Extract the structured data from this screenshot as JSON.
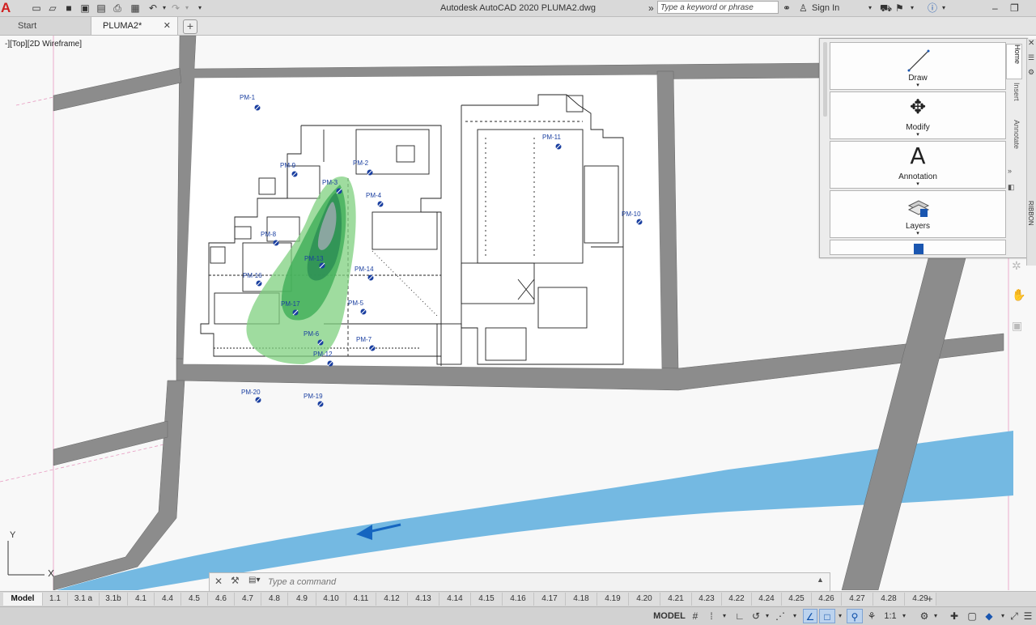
{
  "app": {
    "logo": "A",
    "title": "Autodesk AutoCAD 2020    PLUMA2.dwg",
    "search_placeholder": "Type a keyword or phrase",
    "sign_in": "Sign In"
  },
  "file_tabs": [
    {
      "label": "Start"
    },
    {
      "label": "PLUMA2*"
    }
  ],
  "viewport": {
    "label": "-][Top][2D Wireframe]",
    "axis_y": "Y",
    "axis_x": "X"
  },
  "monitoring_points": [
    "PM-1",
    "PM-2",
    "PM-3",
    "PM-4",
    "PM-5",
    "PM-6",
    "PM-7",
    "PM-8",
    "PM-9",
    "PM-10",
    "PM-11",
    "PM-12",
    "PM-13",
    "PM-14",
    "PM-16",
    "PM-17",
    "PM-19",
    "PM-20"
  ],
  "palette": {
    "panels": [
      "Draw",
      "Modify",
      "Annotation",
      "Layers"
    ],
    "tabs": [
      "Home",
      "Insert",
      "Annotate"
    ],
    "side_title": "RIBBON"
  },
  "command": {
    "placeholder": "Type a command"
  },
  "layout_tabs": [
    "Model",
    "1.1",
    "3.1 a",
    "3.1b",
    "4.1",
    "4.4",
    "4.5",
    "4.6",
    "4.7",
    "4.8",
    "4.9",
    "4.10",
    "4.11",
    "4.12",
    "4.13",
    "4.14",
    "4.15",
    "4.16",
    "4.17",
    "4.18",
    "4.19",
    "4.20",
    "4.21",
    "4.23",
    "4.22",
    "4.24",
    "4.25",
    "4.26",
    "4.27",
    "4.28",
    "4.29"
  ],
  "status": {
    "model": "MODEL",
    "scale": "1:1"
  },
  "colors": {
    "road": "#8c8c8c",
    "river": "#74b9e2",
    "plume_outer": "#7fd07f",
    "plume_mid": "#3fae57",
    "plume_inner": "#2d8f55",
    "plume_core": "#8aa6a0",
    "marker": "#1a3fa0",
    "accent": "#d01f1f"
  }
}
